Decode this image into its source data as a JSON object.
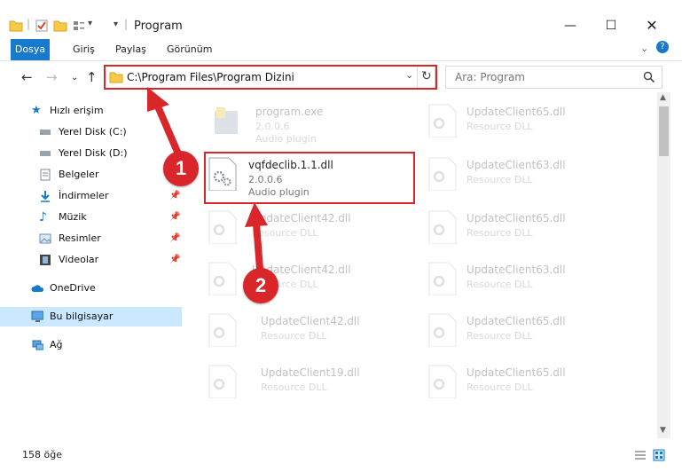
{
  "window": {
    "title": "Program",
    "colors": {
      "accent": "#1979ca",
      "highlight": "#d9262b",
      "selected": "#cce8ff"
    }
  },
  "ribbon": {
    "tabs": [
      "Dosya",
      "Giriş",
      "Paylaş",
      "Görünüm"
    ]
  },
  "address": {
    "path": "C:\\Program Files\\Program Dizini"
  },
  "search": {
    "placeholder": "Ara: Program"
  },
  "sidebar": {
    "quick_access": "Hızlı erişim",
    "items": [
      {
        "label": "Yerel Disk (C:)",
        "icon": "drive-icon",
        "pinned": false
      },
      {
        "label": "Yerel Disk (D:)",
        "icon": "drive-icon",
        "pinned": false
      },
      {
        "label": "Belgeler",
        "icon": "documents-icon",
        "pinned": true
      },
      {
        "label": "İndirmeler",
        "icon": "downloads-icon",
        "pinned": true
      },
      {
        "label": "Müzik",
        "icon": "music-icon",
        "pinned": true
      },
      {
        "label": "Resimler",
        "icon": "pictures-icon",
        "pinned": true
      },
      {
        "label": "Videolar",
        "icon": "videos-icon",
        "pinned": true
      }
    ],
    "onedrive": "OneDrive",
    "this_pc": "Bu bilgisayar",
    "network": "Ağ"
  },
  "files": {
    "highlighted": {
      "name": "vqfdeclib.1.1.dll",
      "version": "2.0.0.6",
      "desc": "Audio plugin"
    },
    "program_exe": {
      "name": "program.exe",
      "version": "2.0.0.6",
      "desc": "Audio plugin"
    },
    "right_column": [
      {
        "name": "UpdateClient65.dll",
        "desc": "Resource DLL"
      },
      {
        "name": "UpdateClient63.dll",
        "desc": "Resource DLL"
      },
      {
        "name": "UpdateClient65.dll",
        "desc": "Resource DLL"
      },
      {
        "name": "UpdateClient63.dll",
        "desc": "Resource DLL"
      },
      {
        "name": "UpdateClient65.dll",
        "desc": "Resource DLL"
      },
      {
        "name": "UpdateClient65.dll",
        "desc": "Resource DLL"
      }
    ],
    "left_column": [
      {
        "name": "UpdateClient42.dll",
        "desc": "Resource DLL"
      },
      {
        "name": "UpdateClient42.dll",
        "desc": "Resource DLL"
      },
      {
        "name": "UpdateClient42.dll",
        "desc": "Resource DLL"
      },
      {
        "name": "UpdateClient19.dll",
        "desc": "Resource DLL"
      }
    ]
  },
  "annotations": {
    "step1": "1",
    "step2": "2"
  },
  "status": {
    "count": "158 öğe"
  }
}
